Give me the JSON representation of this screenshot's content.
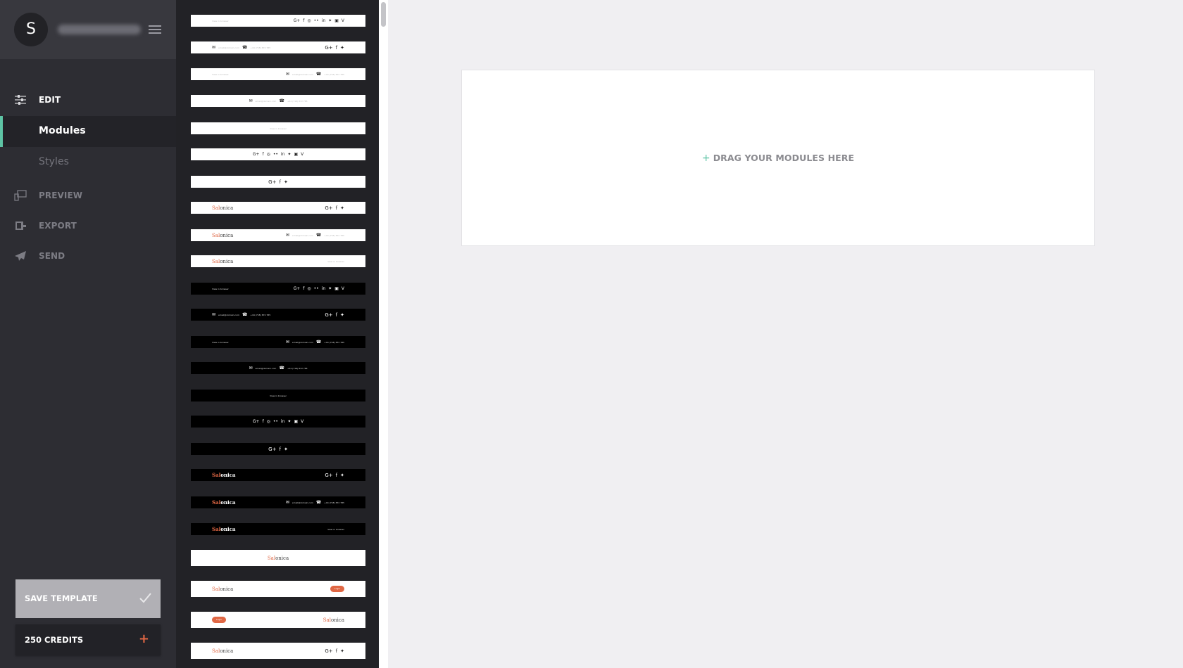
{
  "user": {
    "avatar_initial": "S",
    "username": "saltmaster"
  },
  "nav": {
    "edit_label": "EDIT",
    "modules_label": "Modules",
    "styles_label": "Styles",
    "preview_label": "PREVIEW",
    "export_label": "EXPORT",
    "send_label": "SEND",
    "active_item": "Modules"
  },
  "actions": {
    "save_template_label": "SAVE TEMPLATE",
    "credits_label": "250 CREDITS",
    "credits_plus": "+"
  },
  "canvas": {
    "drop_plus": "+",
    "drop_text": "DRAG YOUR MODULES HERE"
  },
  "colors": {
    "accent": "#5ec4a5",
    "brand_orange": "#e06744",
    "sidebar_bg": "#2d2d33",
    "panel_bg": "#222226",
    "canvas_bg": "#f0eff2"
  },
  "thumbnails": {
    "view_in_browser": "View in browser",
    "email": "email@domain.com",
    "phone": "+44 (718) 872 785",
    "logo_accent": "Sal",
    "logo_rest": "onica",
    "login": "Login",
    "social_full": "G+ f p in in t ig v",
    "social_short": "G+ f t",
    "items": [
      {
        "theme": "light",
        "layout": "browser-left social-full-right"
      },
      {
        "theme": "light",
        "layout": "contact-left social-short-right"
      },
      {
        "theme": "light",
        "layout": "browser-left contact-right"
      },
      {
        "theme": "light",
        "layout": "contact-center"
      },
      {
        "theme": "light",
        "layout": "browser-center"
      },
      {
        "theme": "light",
        "layout": "social-full-center"
      },
      {
        "theme": "light",
        "layout": "social-short-center"
      },
      {
        "theme": "light",
        "layout": "logo-left social-short-right"
      },
      {
        "theme": "light",
        "layout": "logo-left contact-right"
      },
      {
        "theme": "light",
        "layout": "logo-left browser-right"
      },
      {
        "theme": "dark",
        "layout": "browser-left social-full-right"
      },
      {
        "theme": "dark",
        "layout": "contact-left social-short-right"
      },
      {
        "theme": "dark",
        "layout": "browser-left contact-right"
      },
      {
        "theme": "dark",
        "layout": "contact-center"
      },
      {
        "theme": "dark",
        "layout": "browser-center"
      },
      {
        "theme": "dark",
        "layout": "social-full-center"
      },
      {
        "theme": "dark",
        "layout": "social-short-center"
      },
      {
        "theme": "dark",
        "layout": "logo-left social-short-right"
      },
      {
        "theme": "dark",
        "layout": "logo-left contact-right"
      },
      {
        "theme": "dark",
        "layout": "logo-left browser-right"
      },
      {
        "theme": "light",
        "layout": "logo-center"
      },
      {
        "theme": "light",
        "layout": "logo-left login-right"
      },
      {
        "theme": "light",
        "layout": "login-left logo-right"
      },
      {
        "theme": "light",
        "layout": "logo-left social-short-right"
      }
    ]
  }
}
